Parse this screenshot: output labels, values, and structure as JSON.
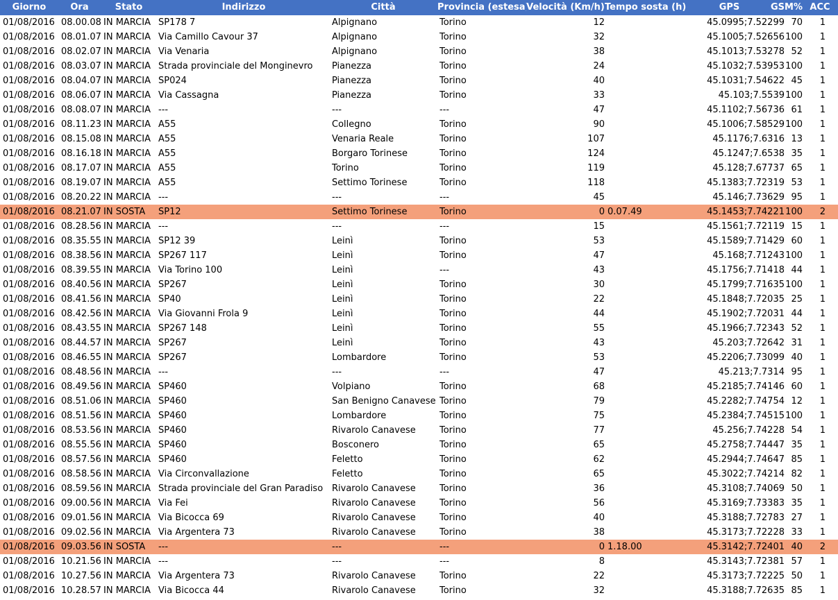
{
  "columns": {
    "giorno": "Giorno",
    "ora": "Ora",
    "stato": "Stato",
    "indirizzo": "Indirizzo",
    "citta": "Città",
    "provincia": "Provincia (estesa)",
    "velocita": "Velocità (Km/h)",
    "tempo_sosta": "Tempo sosta (h)",
    "gps": "GPS",
    "gsm": "GSM%",
    "acc": "ACC"
  },
  "colors": {
    "header_bg": "#4472c4",
    "header_text": "#ffffff",
    "stop_row_bg": "#f4a07b"
  },
  "rows": [
    {
      "giorno": "01/08/2016",
      "ora": "08.00.08",
      "stato": "IN MARCIA",
      "indirizzo": "SP178 7",
      "citta": "Alpignano",
      "provincia": "Torino",
      "velocita": "12",
      "tempo": "",
      "gps": "45.0995;7.52299",
      "gsm": "70",
      "acc": "1",
      "sosta": false
    },
    {
      "giorno": "01/08/2016",
      "ora": "08.01.07",
      "stato": "IN MARCIA",
      "indirizzo": "Via Camillo Cavour 37",
      "citta": "Alpignano",
      "provincia": "Torino",
      "velocita": "32",
      "tempo": "",
      "gps": "45.1005;7.52656",
      "gsm": "100",
      "acc": "1",
      "sosta": false
    },
    {
      "giorno": "01/08/2016",
      "ora": "08.02.07",
      "stato": "IN MARCIA",
      "indirizzo": "Via Venaria",
      "citta": "Alpignano",
      "provincia": "Torino",
      "velocita": "38",
      "tempo": "",
      "gps": "45.1013;7.53278",
      "gsm": "52",
      "acc": "1",
      "sosta": false
    },
    {
      "giorno": "01/08/2016",
      "ora": "08.03.07",
      "stato": "IN MARCIA",
      "indirizzo": "Strada provinciale del Monginevro",
      "citta": "Pianezza",
      "provincia": "Torino",
      "velocita": "24",
      "tempo": "",
      "gps": "45.1032;7.53953",
      "gsm": "100",
      "acc": "1",
      "sosta": false
    },
    {
      "giorno": "01/08/2016",
      "ora": "08.04.07",
      "stato": "IN MARCIA",
      "indirizzo": "SP024",
      "citta": "Pianezza",
      "provincia": "Torino",
      "velocita": "40",
      "tempo": "",
      "gps": "45.1031;7.54622",
      "gsm": "45",
      "acc": "1",
      "sosta": false
    },
    {
      "giorno": "01/08/2016",
      "ora": "08.06.07",
      "stato": "IN MARCIA",
      "indirizzo": "Via Cassagna",
      "citta": "Pianezza",
      "provincia": "Torino",
      "velocita": "33",
      "tempo": "",
      "gps": "45.103;7.5539",
      "gsm": "100",
      "acc": "1",
      "sosta": false
    },
    {
      "giorno": "01/08/2016",
      "ora": "08.08.07",
      "stato": "IN MARCIA",
      "indirizzo": "---",
      "citta": "---",
      "provincia": "---",
      "velocita": "47",
      "tempo": "",
      "gps": "45.1102;7.56736",
      "gsm": "61",
      "acc": "1",
      "sosta": false
    },
    {
      "giorno": "01/08/2016",
      "ora": "08.11.23",
      "stato": "IN MARCIA",
      "indirizzo": "A55",
      "citta": "Collegno",
      "provincia": "Torino",
      "velocita": "90",
      "tempo": "",
      "gps": "45.1006;7.58529",
      "gsm": "100",
      "acc": "1",
      "sosta": false
    },
    {
      "giorno": "01/08/2016",
      "ora": "08.15.08",
      "stato": "IN MARCIA",
      "indirizzo": "A55",
      "citta": "Venaria Reale",
      "provincia": "Torino",
      "velocita": "107",
      "tempo": "",
      "gps": "45.1176;7.6316",
      "gsm": "13",
      "acc": "1",
      "sosta": false
    },
    {
      "giorno": "01/08/2016",
      "ora": "08.16.18",
      "stato": "IN MARCIA",
      "indirizzo": "A55",
      "citta": "Borgaro Torinese",
      "provincia": "Torino",
      "velocita": "124",
      "tempo": "",
      "gps": "45.1247;7.6538",
      "gsm": "35",
      "acc": "1",
      "sosta": false
    },
    {
      "giorno": "01/08/2016",
      "ora": "08.17.07",
      "stato": "IN MARCIA",
      "indirizzo": "A55",
      "citta": "Torino",
      "provincia": "Torino",
      "velocita": "119",
      "tempo": "",
      "gps": "45.128;7.67737",
      "gsm": "65",
      "acc": "1",
      "sosta": false
    },
    {
      "giorno": "01/08/2016",
      "ora": "08.19.07",
      "stato": "IN MARCIA",
      "indirizzo": "A55",
      "citta": "Settimo Torinese",
      "provincia": "Torino",
      "velocita": "118",
      "tempo": "",
      "gps": "45.1383;7.72319",
      "gsm": "53",
      "acc": "1",
      "sosta": false
    },
    {
      "giorno": "01/08/2016",
      "ora": "08.20.22",
      "stato": "IN MARCIA",
      "indirizzo": "---",
      "citta": "---",
      "provincia": "---",
      "velocita": "45",
      "tempo": "",
      "gps": "45.146;7.73629",
      "gsm": "95",
      "acc": "1",
      "sosta": false
    },
    {
      "giorno": "01/08/2016",
      "ora": "08.21.07",
      "stato": "IN SOSTA",
      "indirizzo": "SP12",
      "citta": "Settimo Torinese",
      "provincia": "Torino",
      "velocita": "0",
      "tempo": "0.07.49",
      "gps": "45.1453;7.74221",
      "gsm": "100",
      "acc": "2",
      "sosta": true
    },
    {
      "giorno": "01/08/2016",
      "ora": "08.28.56",
      "stato": "IN MARCIA",
      "indirizzo": "---",
      "citta": "---",
      "provincia": "---",
      "velocita": "15",
      "tempo": "",
      "gps": "45.1561;7.72119",
      "gsm": "15",
      "acc": "1",
      "sosta": false
    },
    {
      "giorno": "01/08/2016",
      "ora": "08.35.55",
      "stato": "IN MARCIA",
      "indirizzo": "SP12 39",
      "citta": "Leinì",
      "provincia": "Torino",
      "velocita": "53",
      "tempo": "",
      "gps": "45.1589;7.71429",
      "gsm": "60",
      "acc": "1",
      "sosta": false
    },
    {
      "giorno": "01/08/2016",
      "ora": "08.38.56",
      "stato": "IN MARCIA",
      "indirizzo": "SP267 117",
      "citta": "Leinì",
      "provincia": "Torino",
      "velocita": "47",
      "tempo": "",
      "gps": "45.168;7.71243",
      "gsm": "100",
      "acc": "1",
      "sosta": false
    },
    {
      "giorno": "01/08/2016",
      "ora": "08.39.55",
      "stato": "IN MARCIA",
      "indirizzo": "Via Torino 100",
      "citta": "Leinì",
      "provincia": "---",
      "velocita": "43",
      "tempo": "",
      "gps": "45.1756;7.71418",
      "gsm": "44",
      "acc": "1",
      "sosta": false
    },
    {
      "giorno": "01/08/2016",
      "ora": "08.40.56",
      "stato": "IN MARCIA",
      "indirizzo": "SP267",
      "citta": "Leinì",
      "provincia": "Torino",
      "velocita": "30",
      "tempo": "",
      "gps": "45.1799;7.71635",
      "gsm": "100",
      "acc": "1",
      "sosta": false
    },
    {
      "giorno": "01/08/2016",
      "ora": "08.41.56",
      "stato": "IN MARCIA",
      "indirizzo": "SP40",
      "citta": "Leinì",
      "provincia": "Torino",
      "velocita": "22",
      "tempo": "",
      "gps": "45.1848;7.72035",
      "gsm": "25",
      "acc": "1",
      "sosta": false
    },
    {
      "giorno": "01/08/2016",
      "ora": "08.42.56",
      "stato": "IN MARCIA",
      "indirizzo": "Via Giovanni Frola 9",
      "citta": "Leinì",
      "provincia": "Torino",
      "velocita": "44",
      "tempo": "",
      "gps": "45.1902;7.72031",
      "gsm": "44",
      "acc": "1",
      "sosta": false
    },
    {
      "giorno": "01/08/2016",
      "ora": "08.43.55",
      "stato": "IN MARCIA",
      "indirizzo": "SP267 148",
      "citta": "Leinì",
      "provincia": "Torino",
      "velocita": "55",
      "tempo": "",
      "gps": "45.1966;7.72343",
      "gsm": "52",
      "acc": "1",
      "sosta": false
    },
    {
      "giorno": "01/08/2016",
      "ora": "08.44.57",
      "stato": "IN MARCIA",
      "indirizzo": "SP267",
      "citta": "Leinì",
      "provincia": "Torino",
      "velocita": "43",
      "tempo": "",
      "gps": "45.203;7.72642",
      "gsm": "31",
      "acc": "1",
      "sosta": false
    },
    {
      "giorno": "01/08/2016",
      "ora": "08.46.55",
      "stato": "IN MARCIA",
      "indirizzo": "SP267",
      "citta": "Lombardore",
      "provincia": "Torino",
      "velocita": "53",
      "tempo": "",
      "gps": "45.2206;7.73099",
      "gsm": "40",
      "acc": "1",
      "sosta": false
    },
    {
      "giorno": "01/08/2016",
      "ora": "08.48.56",
      "stato": "IN MARCIA",
      "indirizzo": "---",
      "citta": "---",
      "provincia": "---",
      "velocita": "47",
      "tempo": "",
      "gps": "45.213;7.7314",
      "gsm": "95",
      "acc": "1",
      "sosta": false
    },
    {
      "giorno": "01/08/2016",
      "ora": "08.49.56",
      "stato": "IN MARCIA",
      "indirizzo": "SP460",
      "citta": "Volpiano",
      "provincia": "Torino",
      "velocita": "68",
      "tempo": "",
      "gps": "45.2185;7.74146",
      "gsm": "60",
      "acc": "1",
      "sosta": false
    },
    {
      "giorno": "01/08/2016",
      "ora": "08.51.06",
      "stato": "IN MARCIA",
      "indirizzo": "SP460",
      "citta": "San Benigno Canavese",
      "provincia": "Torino",
      "velocita": "79",
      "tempo": "",
      "gps": "45.2282;7.74754",
      "gsm": "12",
      "acc": "1",
      "sosta": false
    },
    {
      "giorno": "01/08/2016",
      "ora": "08.51.56",
      "stato": "IN MARCIA",
      "indirizzo": "SP460",
      "citta": "Lombardore",
      "provincia": "Torino",
      "velocita": "75",
      "tempo": "",
      "gps": "45.2384;7.74515",
      "gsm": "100",
      "acc": "1",
      "sosta": false
    },
    {
      "giorno": "01/08/2016",
      "ora": "08.53.56",
      "stato": "IN MARCIA",
      "indirizzo": "SP460",
      "citta": "Rivarolo Canavese",
      "provincia": "Torino",
      "velocita": "77",
      "tempo": "",
      "gps": "45.256;7.74228",
      "gsm": "54",
      "acc": "1",
      "sosta": false
    },
    {
      "giorno": "01/08/2016",
      "ora": "08.55.56",
      "stato": "IN MARCIA",
      "indirizzo": "SP460",
      "citta": "Bosconero",
      "provincia": "Torino",
      "velocita": "65",
      "tempo": "",
      "gps": "45.2758;7.74447",
      "gsm": "35",
      "acc": "1",
      "sosta": false
    },
    {
      "giorno": "01/08/2016",
      "ora": "08.57.56",
      "stato": "IN MARCIA",
      "indirizzo": "SP460",
      "citta": "Feletto",
      "provincia": "Torino",
      "velocita": "62",
      "tempo": "",
      "gps": "45.2944;7.74647",
      "gsm": "85",
      "acc": "1",
      "sosta": false
    },
    {
      "giorno": "01/08/2016",
      "ora": "08.58.56",
      "stato": "IN MARCIA",
      "indirizzo": "Via Circonvallazione",
      "citta": "Feletto",
      "provincia": "Torino",
      "velocita": "65",
      "tempo": "",
      "gps": "45.3022;7.74214",
      "gsm": "82",
      "acc": "1",
      "sosta": false
    },
    {
      "giorno": "01/08/2016",
      "ora": "08.59.56",
      "stato": "IN MARCIA",
      "indirizzo": "Strada provinciale del Gran Paradiso",
      "citta": "Rivarolo Canavese",
      "provincia": "Torino",
      "velocita": "36",
      "tempo": "",
      "gps": "45.3108;7.74069",
      "gsm": "50",
      "acc": "1",
      "sosta": false
    },
    {
      "giorno": "01/08/2016",
      "ora": "09.00.56",
      "stato": "IN MARCIA",
      "indirizzo": "Via Fei",
      "citta": "Rivarolo Canavese",
      "provincia": "Torino",
      "velocita": "56",
      "tempo": "",
      "gps": "45.3169;7.73383",
      "gsm": "35",
      "acc": "1",
      "sosta": false
    },
    {
      "giorno": "01/08/2016",
      "ora": "09.01.56",
      "stato": "IN MARCIA",
      "indirizzo": "Via Bicocca 69",
      "citta": "Rivarolo Canavese",
      "provincia": "Torino",
      "velocita": "40",
      "tempo": "",
      "gps": "45.3188;7.72783",
      "gsm": "27",
      "acc": "1",
      "sosta": false
    },
    {
      "giorno": "01/08/2016",
      "ora": "09.02.56",
      "stato": "IN MARCIA",
      "indirizzo": "Via Argentera 73",
      "citta": "Rivarolo Canavese",
      "provincia": "Torino",
      "velocita": "38",
      "tempo": "",
      "gps": "45.3173;7.72228",
      "gsm": "33",
      "acc": "1",
      "sosta": false
    },
    {
      "giorno": "01/08/2016",
      "ora": "09.03.56",
      "stato": "IN SOSTA",
      "indirizzo": "---",
      "citta": "---",
      "provincia": "---",
      "velocita": "0",
      "tempo": "1.18.00",
      "gps": "45.3142;7.72401",
      "gsm": "40",
      "acc": "2",
      "sosta": true
    },
    {
      "giorno": "01/08/2016",
      "ora": "10.21.56",
      "stato": "IN MARCIA",
      "indirizzo": "---",
      "citta": "---",
      "provincia": "---",
      "velocita": "8",
      "tempo": "",
      "gps": "45.3143;7.72381",
      "gsm": "57",
      "acc": "1",
      "sosta": false
    },
    {
      "giorno": "01/08/2016",
      "ora": "10.27.56",
      "stato": "IN MARCIA",
      "indirizzo": "Via Argentera 73",
      "citta": "Rivarolo Canavese",
      "provincia": "Torino",
      "velocita": "22",
      "tempo": "",
      "gps": "45.3173;7.72225",
      "gsm": "50",
      "acc": "1",
      "sosta": false
    },
    {
      "giorno": "01/08/2016",
      "ora": "10.28.57",
      "stato": "IN MARCIA",
      "indirizzo": "Via Bicocca 44",
      "citta": "Rivarolo Canavese",
      "provincia": "Torino",
      "velocita": "32",
      "tempo": "",
      "gps": "45.3188;7.72635",
      "gsm": "85",
      "acc": "1",
      "sosta": false
    }
  ]
}
